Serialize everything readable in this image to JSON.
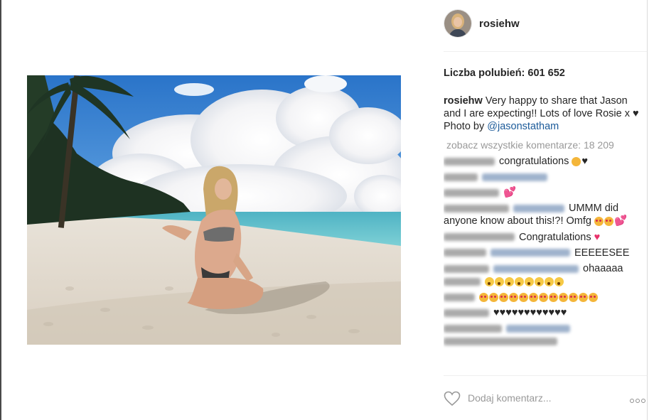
{
  "post": {
    "username": "rosiehw",
    "likes_label": "Liczba polubień: 601 652",
    "caption": {
      "username": "rosiehw",
      "text": "Very happy to share that Jason and I are expecting!! Lots of love Rosie x ♥",
      "photo_by": "Photo by",
      "mention": "@jasonstatham"
    },
    "view_all_comments": "zobacz wszystkie komentarze: 18 209"
  },
  "comments": [
    {
      "user_blurred": true,
      "text": "congratulations",
      "trailing": "♥"
    },
    {
      "user_blurred": true,
      "text": "",
      "mention_blurred": true
    },
    {
      "user_blurred": true,
      "text": "",
      "trailing": "💕"
    },
    {
      "user_blurred": true,
      "text": "UMMM did anyone know about this!?! Omfg",
      "mention_blurred": true
    },
    {
      "user_blurred": true,
      "text": "Congratulations",
      "trailing": "♥"
    },
    {
      "user_blurred": true,
      "text": "EEEEESEE",
      "mention_blurred": true
    },
    {
      "user_blurred": true,
      "text": "ohaaaaa",
      "mention_blurred": true
    },
    {
      "user_blurred": true,
      "text": "",
      "trailing": ""
    },
    {
      "user_blurred": true,
      "text": "♥♥♥♥♥♥♥♥♥♥♥♥"
    },
    {
      "user_blurred": true,
      "text": "",
      "mention_blurred": true
    }
  ],
  "footer": {
    "comment_placeholder": "Dodaj komentarz..."
  },
  "colors": {
    "link": "#1b5a99",
    "muted": "#999999",
    "heart_pink": "#e8326b"
  },
  "icons": [
    "heart-outline-icon",
    "more-options-icon"
  ]
}
